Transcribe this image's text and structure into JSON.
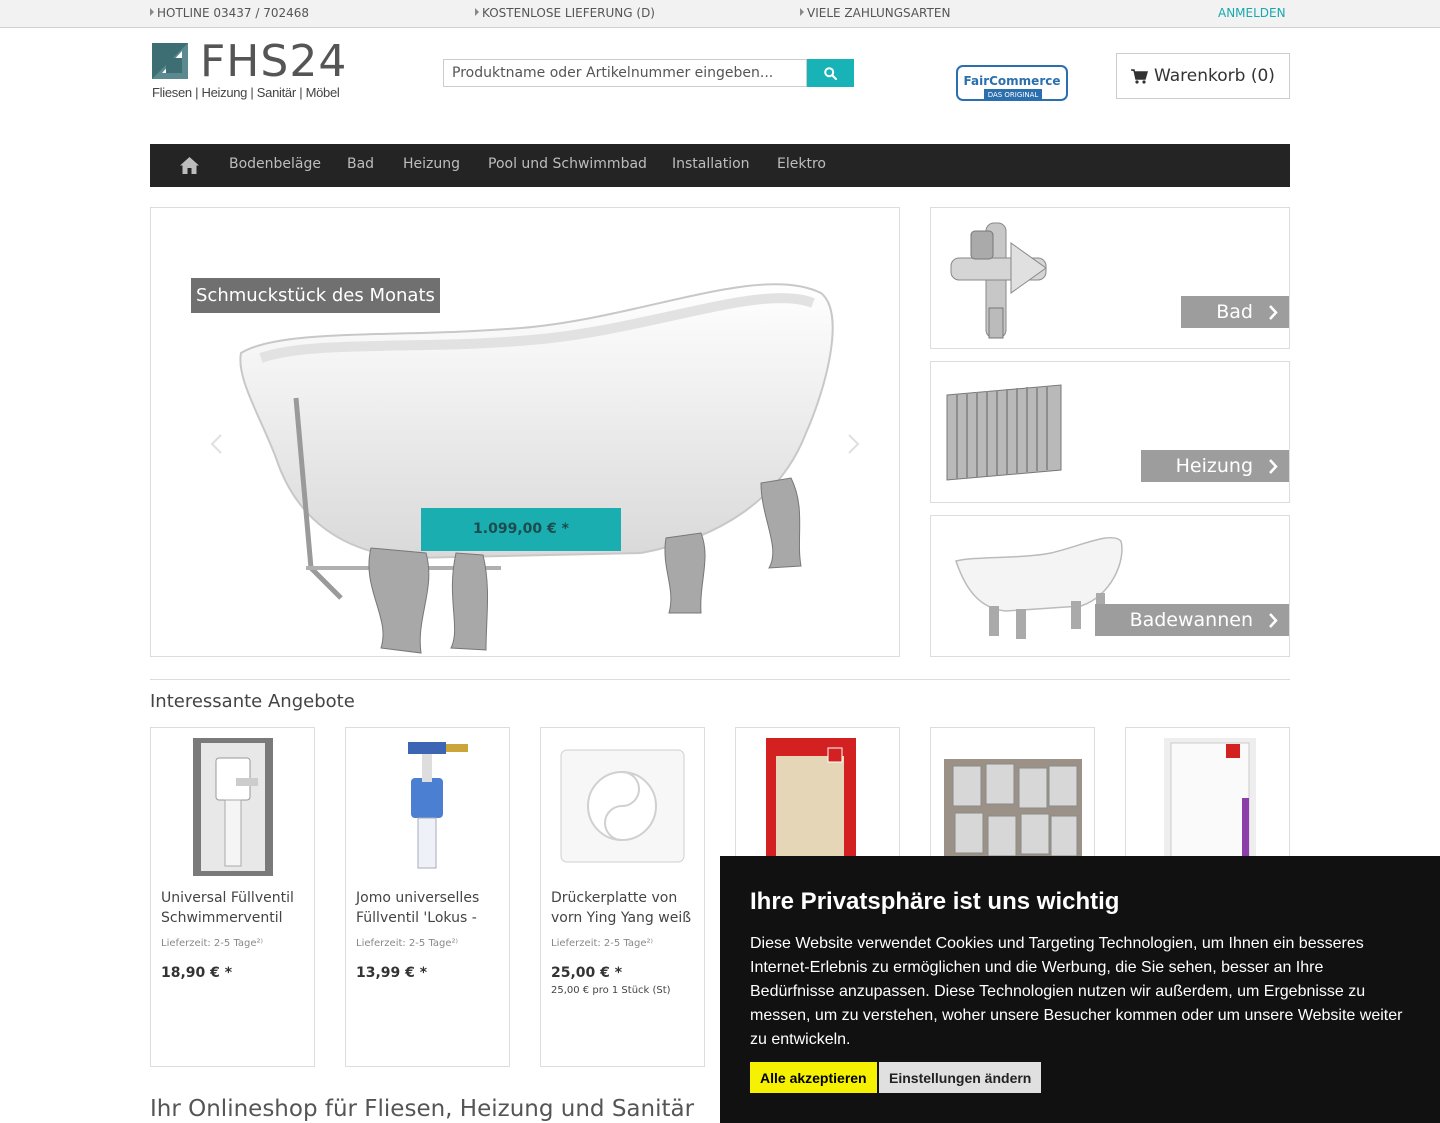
{
  "topbar": {
    "hotline": "HOTLINE 03437 / 702468",
    "delivery": "KOSTENLOSE LIEFERUNG (D)",
    "payment": "VIELE ZAHLUNGSARTEN",
    "login": "ANMELDEN"
  },
  "header": {
    "logo_text": "FHS24",
    "logo_sub": "Fliesen | Heizung | Sanitär | Möbel",
    "search_placeholder": "Produktname oder Artikelnummer eingeben...",
    "search_icon": "search-icon",
    "badge_text": "FairCommerce",
    "badge_sub": "DAS ORIGINAL",
    "cart_label": "Warenkorb (0)",
    "cart_icon": "shopping-cart-icon"
  },
  "nav": {
    "home_icon": "home-icon",
    "items": [
      "Bodenbeläge",
      "Bad",
      "Heizung",
      "Pool und Schwimmbad",
      "Installation",
      "Elektro"
    ]
  },
  "slider": {
    "caption": "Schmuckstück des Monats",
    "price": "1.099,00 € *"
  },
  "tiles": [
    {
      "label": "Bad",
      "icon": "angle-valve-icon"
    },
    {
      "label": "Heizung",
      "icon": "radiator-icon"
    },
    {
      "label": "Badewannen",
      "icon": "bathtub-icon"
    }
  ],
  "offers": {
    "title": "Interessante Angebote",
    "products": [
      {
        "name": "Universal Füllventil Schwimmerventil",
        "delivery": "Lieferzeit: 2-5 Tage²⁾",
        "price": "18,90 € *",
        "unit": ""
      },
      {
        "name": "Jomo universelles Füllventil 'Lokus -",
        "delivery": "Lieferzeit: 2-5 Tage²⁾",
        "price": "13,99 € *",
        "unit": ""
      },
      {
        "name": "Drückerplatte von vorn Ying Yang weiß",
        "delivery": "Lieferzeit: 2-5 Tage²⁾",
        "price": "25,00 € *",
        "unit": "25,00 € pro 1 Stück (St)"
      },
      {
        "name": "",
        "delivery": "",
        "price": "",
        "unit": ""
      },
      {
        "name": "",
        "delivery": "",
        "price": "",
        "unit": ""
      },
      {
        "name": "",
        "delivery": "",
        "price": "",
        "unit": ""
      }
    ]
  },
  "bottom_heading": "Ihr Onlineshop für Fliesen, Heizung und Sanitär",
  "cookie": {
    "title": "Ihre Privatsphäre ist uns wichtig",
    "text": "Diese Website verwendet Cookies und Targeting Technologien, um Ihnen ein besseres Internet-Erlebnis zu ermöglichen und die Werbung, die Sie sehen, besser an Ihre Bedürfnisse anzupassen. Diese Technologien nutzen wir außerdem, um Ergebnisse zu messen, um zu verstehen, woher unsere Besucher kommen oder um unsere Website weiter zu entwickeln.",
    "accept": "Alle akzeptieren",
    "settings": "Einstellungen ändern"
  },
  "colors": {
    "accent": "#18b3b6",
    "nav_bg": "#242424",
    "tile_label_bg": "#9d9d9d",
    "cookie_bg": "#111111",
    "accept_bg": "#f5f100"
  }
}
